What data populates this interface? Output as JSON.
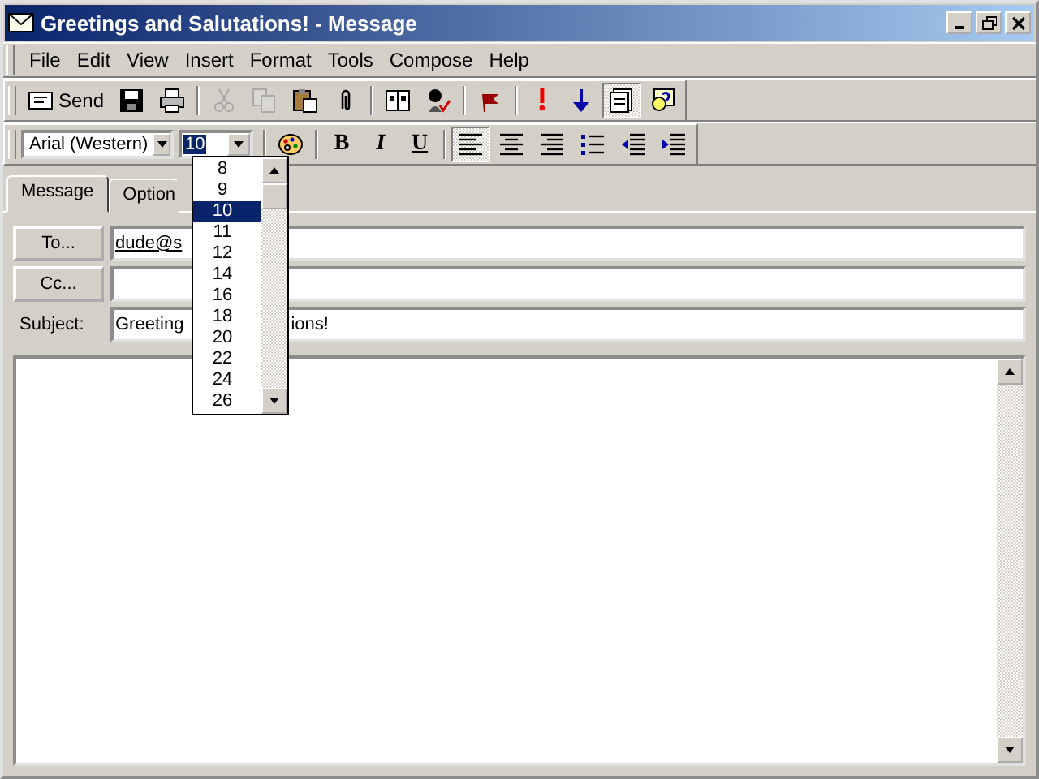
{
  "window": {
    "title": "Greetings and Salutations! - Message"
  },
  "menu": [
    "File",
    "Edit",
    "View",
    "Insert",
    "Format",
    "Tools",
    "Compose",
    "Help"
  ],
  "standard_toolbar": {
    "groups": [
      [
        {
          "kind": "send",
          "label": "Send",
          "disabled": false,
          "pressed": false
        },
        {
          "kind": "save",
          "disabled": false,
          "pressed": false
        },
        {
          "kind": "print",
          "disabled": false,
          "pressed": false
        }
      ],
      [
        {
          "kind": "cut",
          "disabled": true,
          "pressed": false
        },
        {
          "kind": "copy",
          "disabled": true,
          "pressed": false
        },
        {
          "kind": "paste",
          "disabled": false,
          "pressed": false
        },
        {
          "kind": "attach",
          "disabled": false,
          "pressed": false
        }
      ],
      [
        {
          "kind": "addressbook",
          "disabled": false,
          "pressed": false
        },
        {
          "kind": "checknames",
          "disabled": false,
          "pressed": false
        }
      ],
      [
        {
          "kind": "flag",
          "disabled": false,
          "pressed": false
        }
      ],
      [
        {
          "kind": "high",
          "disabled": false,
          "pressed": false
        },
        {
          "kind": "low",
          "disabled": false,
          "pressed": false
        },
        {
          "kind": "options",
          "disabled": false,
          "pressed": true
        },
        {
          "kind": "help",
          "disabled": false,
          "pressed": false
        }
      ]
    ]
  },
  "format_toolbar": {
    "font": "Arial (Western)",
    "size": "10",
    "groups": [
      [
        {
          "kind": "color",
          "pressed": false
        }
      ],
      [
        {
          "kind": "bold",
          "label": "B",
          "pressed": false
        },
        {
          "kind": "italic",
          "label": "I",
          "pressed": false
        },
        {
          "kind": "underline",
          "label": "U",
          "pressed": false
        }
      ],
      [
        {
          "kind": "alignleft",
          "pressed": true
        },
        {
          "kind": "center",
          "pressed": false
        },
        {
          "kind": "alignright",
          "pressed": false
        },
        {
          "kind": "bullets",
          "pressed": false
        },
        {
          "kind": "outdent",
          "pressed": false
        },
        {
          "kind": "indent",
          "pressed": false
        }
      ]
    ]
  },
  "size_dropdown": {
    "items": [
      {
        "label": "8",
        "selected": false
      },
      {
        "label": "9",
        "selected": false
      },
      {
        "label": "10",
        "selected": true
      },
      {
        "label": "11",
        "selected": false
      },
      {
        "label": "12",
        "selected": false
      },
      {
        "label": "14",
        "selected": false
      },
      {
        "label": "16",
        "selected": false
      },
      {
        "label": "18",
        "selected": false
      },
      {
        "label": "20",
        "selected": false
      },
      {
        "label": "22",
        "selected": false
      },
      {
        "label": "24",
        "selected": false
      },
      {
        "label": "26",
        "selected": false
      }
    ]
  },
  "tabs": [
    {
      "label": "Message",
      "selected": true
    },
    {
      "label": "Option",
      "selected": false
    }
  ],
  "to": {
    "button": "To...",
    "value": "dude@s"
  },
  "cc": {
    "button": "Cc..."
  },
  "subject": {
    "label": "Subject:",
    "visible_parts": [
      "Greeting",
      "ions!"
    ]
  }
}
